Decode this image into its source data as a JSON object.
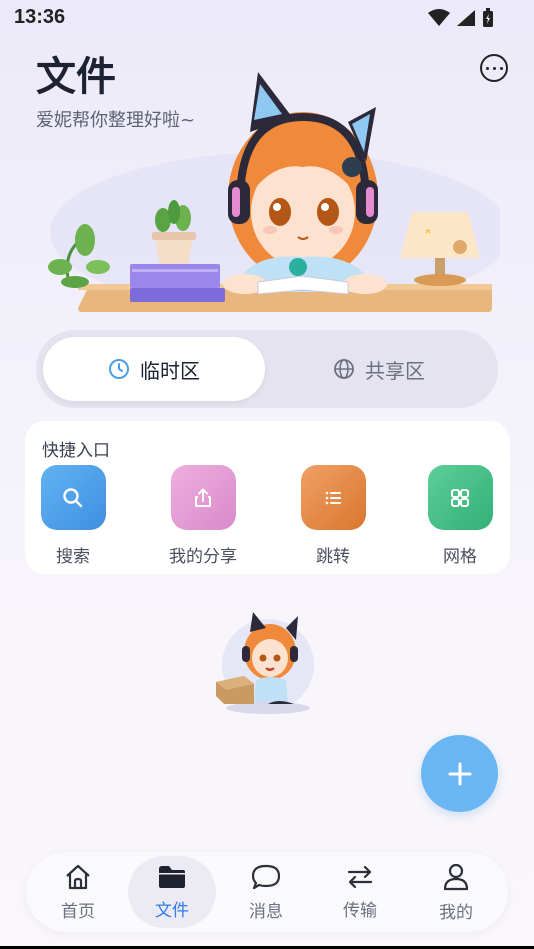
{
  "status": {
    "time": "13:36"
  },
  "header": {
    "title": "文件",
    "subtitle": "爱妮帮你整理好啦~"
  },
  "icons": {
    "more": "more-icon",
    "clock": "clock-icon",
    "globe": "globe-icon",
    "search": "search-icon",
    "share": "share-icon",
    "list": "list-icon",
    "grid": "grid-icon",
    "add": "plus-icon",
    "home": "home-icon",
    "folder": "folder-icon",
    "message": "chat-icon",
    "transfer": "transfer-icon",
    "user": "user-icon"
  },
  "segments": [
    {
      "label": "临时区",
      "active": true
    },
    {
      "label": "共享区",
      "active": false
    }
  ],
  "quick": {
    "title": "快捷入口",
    "items": [
      {
        "label": "搜索",
        "color": "#4a9fe8"
      },
      {
        "label": "我的分享",
        "color": "#e39bd4"
      },
      {
        "label": "跳转",
        "color": "#e48a46"
      },
      {
        "label": "网格",
        "color": "#46c08a"
      }
    ]
  },
  "nav": [
    {
      "label": "首页",
      "active": false
    },
    {
      "label": "文件",
      "active": true
    },
    {
      "label": "消息",
      "active": false
    },
    {
      "label": "传输",
      "active": false
    },
    {
      "label": "我的",
      "active": false
    }
  ],
  "colors": {
    "accent": "#2f7cf0",
    "fab": "#6ab6f4"
  }
}
